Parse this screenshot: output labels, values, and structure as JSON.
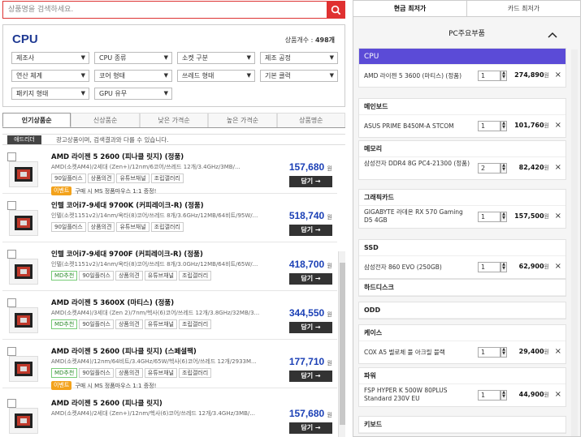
{
  "search": {
    "placeholder": "상품명을 검색하세요."
  },
  "category": {
    "title": "CPU",
    "count_label": "상품개수 :",
    "count_value": "498개"
  },
  "filters": [
    "제조사",
    "CPU 종류",
    "소켓 구분",
    "제조 공정",
    "연산 체계",
    "코어 형태",
    "쓰레드 형태",
    "기본 클럭",
    "패키지 형태",
    "GPU 유무"
  ],
  "tabs": [
    "인기상품순",
    "신상품순",
    "낮은 가격순",
    "높은 가격순",
    "상품명순"
  ],
  "notice": {
    "badge": "애드리더",
    "text": "광고상품이며, 검색결과와 다를 수 있습니다."
  },
  "products": [
    {
      "name": "AMD 라이젠 5 2600 (피나클 릿지) (정품)",
      "spec": "AMD(소켓AM4)/2세대 (Zen+)/12nm/6코어/쓰레드 12개/3.4GHz/3MB/...",
      "tags": [
        "90일플러스",
        "상품의견",
        "유튜브채널",
        "조립갤러리"
      ],
      "md": "",
      "event_badge": "이벤트",
      "event_text": "구매 시 MS 정품마우스 1:1 증정!",
      "price": "157,680",
      "unit": "원",
      "cart": "담기 →"
    },
    {
      "name": "인텔 코어i7-9세대 9700K (커피레이크-R) (정품)",
      "spec": "인텔(소켓1151v2)/14nm/옥타(8)코어/쓰레드 8개/3.6GHz/12MB/64비트/95W/...",
      "tags": [
        "90일플러스",
        "상품의견",
        "유튜브채널",
        "조립갤러리"
      ],
      "md": "",
      "event_badge": "",
      "event_text": "",
      "price": "518,740",
      "unit": "원",
      "cart": "담기 →"
    },
    {
      "name": "인텔 코어i7-9세대 9700F (커피레이크-R) (정품)",
      "spec": "인텔(소켓1151v2)/14nm/옥타(8)코어/쓰레드 8개/3.0GHz/12MB/64비트/65W/...",
      "tags": [
        "90일플러스",
        "상품의견",
        "유튜브채널",
        "조립갤러리"
      ],
      "md": "MD추천",
      "event_badge": "",
      "event_text": "",
      "price": "418,700",
      "unit": "원",
      "cart": "담기 →"
    },
    {
      "name": "AMD 라이젠 5 3600X (마티스) (정품)",
      "spec": "AMD(소켓AM4)/3세대 (Zen 2)/7nm/헥사(6)코어/쓰레드 12개/3.8GHz/32MB/3...",
      "tags": [
        "90일플러스",
        "상품의견",
        "유튜브채널",
        "조립갤러리"
      ],
      "md": "MD추천",
      "event_badge": "",
      "event_text": "",
      "price": "344,550",
      "unit": "원",
      "cart": "담기 →"
    },
    {
      "name": "AMD 라이젠 5 2600 (피나클 릿지) (스페셜팩)",
      "spec": "AMD(소켓AM4)/12nm/64비트/3.4GHz/65W/헥사(6)코어/쓰레드 12개/2933M...",
      "tags": [
        "90일플러스",
        "상품의견",
        "유튜브채널",
        "조립갤러리"
      ],
      "md": "MD추천",
      "event_badge": "이벤트",
      "event_text": "구매 시 MS 정품마우스 1:1 증정!",
      "price": "177,710",
      "unit": "원",
      "cart": "담기 →"
    },
    {
      "name": "AMD 라이젠 5 2600 (피나클 릿지)",
      "spec": "AMD(소켓AM4)/2세대 (Zen+)/12nm/헥사(6)코어/쓰레드 12개/3.4GHz/3MB/...",
      "tags": [],
      "md": "",
      "event_badge": "",
      "event_text": "",
      "price": "157,680",
      "unit": "원",
      "cart": "담기 →"
    }
  ],
  "right": {
    "tabs": [
      "현금 최저가",
      "카드 최저가"
    ],
    "section": "PC주요부품",
    "groups": [
      {
        "name": "CPU",
        "active": true,
        "item": {
          "name": "AMD 라이젠 5 3600 (마티스) (정품)",
          "qty": "1",
          "price": "274,890",
          "unit": "원"
        }
      },
      {
        "name": "메인보드",
        "item": {
          "name": "ASUS PRIME B450M-A STCOM",
          "qty": "1",
          "price": "101,760",
          "unit": "원"
        }
      },
      {
        "name": "메모리",
        "item": {
          "name": "삼성전자 DDR4 8G PC4-21300 (정품)",
          "qty": "2",
          "price": "82,420",
          "unit": "원"
        }
      },
      {
        "name": "그래픽카드",
        "item": {
          "name": "GIGABYTE 라데온 RX 570 Gaming D5 4GB",
          "qty": "1",
          "price": "157,500",
          "unit": "원"
        }
      },
      {
        "name": "SSD",
        "item": {
          "name": "삼성전자 860 EVO (250GB)",
          "qty": "1",
          "price": "62,900",
          "unit": "원"
        }
      },
      {
        "name": "하드디스크"
      },
      {
        "name": "ODD"
      },
      {
        "name": "케이스",
        "item": {
          "name": "COX A5 벨로체 풀 아크릴 블랙",
          "qty": "1",
          "price": "29,400",
          "unit": "원"
        }
      },
      {
        "name": "파워",
        "item": {
          "name": "FSP HYPER K 500W 80PLUS Standard 230V EU",
          "qty": "1",
          "price": "44,900",
          "unit": "원"
        }
      },
      {
        "name": "키보드"
      }
    ]
  },
  "colors": {
    "accent": "#5b4bd7",
    "price": "#1a3fb5",
    "search": "#e03030",
    "event": "#f3a21b"
  }
}
